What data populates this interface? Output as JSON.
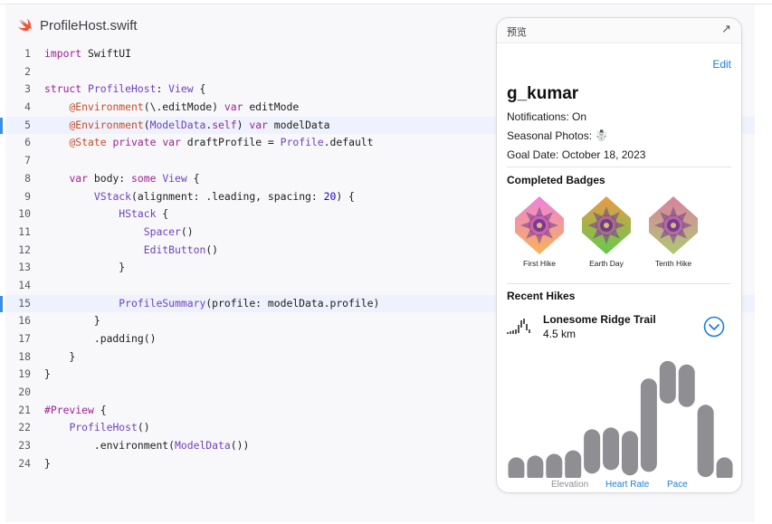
{
  "editor": {
    "file_title": "ProfileHost.swift",
    "lines": [
      {
        "n": "1",
        "html": "<span class=\"kw\">import</span> SwiftUI"
      },
      {
        "n": "2",
        "html": ""
      },
      {
        "n": "3",
        "html": "<span class=\"kw\">struct</span> <span class=\"ty\">ProfileHost</span>: <span class=\"ty\">View</span> {"
      },
      {
        "n": "4",
        "html": "    <span class=\"at\">@Environment</span>(\\.editMode) <span class=\"kw\">var</span> editMode"
      },
      {
        "n": "5",
        "html": "    <span class=\"at\">@Environment</span>(<span class=\"ty\">ModelData</span>.<span class=\"kw\">self</span>) <span class=\"kw\">var</span> modelData",
        "hl": true
      },
      {
        "n": "6",
        "html": "    <span class=\"at\">@State</span> <span class=\"kw\">private</span> <span class=\"kw\">var</span> draftProfile = <span class=\"ty\">Profile</span>.default"
      },
      {
        "n": "7",
        "html": ""
      },
      {
        "n": "8",
        "html": "    <span class=\"kw\">var</span> body: <span class=\"kw\">some</span> <span class=\"ty\">View</span> {"
      },
      {
        "n": "9",
        "html": "        <span class=\"ty\">VStack</span>(alignment: .leading, spacing: <span class=\"nm\">20</span>) {"
      },
      {
        "n": "10",
        "html": "            <span class=\"ty\">HStack</span> {"
      },
      {
        "n": "11",
        "html": "                <span class=\"ty\">Spacer</span>()"
      },
      {
        "n": "12",
        "html": "                <span class=\"ty\">EditButton</span>()"
      },
      {
        "n": "13",
        "html": "            }"
      },
      {
        "n": "14",
        "html": ""
      },
      {
        "n": "15",
        "html": "            <span class=\"ty\">ProfileSummary</span>(profile: modelData.profile)",
        "hl": true
      },
      {
        "n": "16",
        "html": "        }"
      },
      {
        "n": "17",
        "html": "        .padding()"
      },
      {
        "n": "18",
        "html": "    }"
      },
      {
        "n": "19",
        "html": "}"
      },
      {
        "n": "20",
        "html": ""
      },
      {
        "n": "21",
        "html": "<span class=\"kw\">#Preview</span> {"
      },
      {
        "n": "22",
        "html": "    <span class=\"ty\">ProfileHost</span>()"
      },
      {
        "n": "23",
        "html": "        .environment(<span class=\"ty\">ModelData</span>())"
      },
      {
        "n": "24",
        "html": "}"
      }
    ]
  },
  "preview": {
    "title": "预览",
    "expand_icon": "arrow-up-right-icon",
    "edit_label": "Edit",
    "username": "g_kumar",
    "notifications": "Notifications: On",
    "seasonal_photos": "Seasonal Photos: ☃️",
    "goal_date": "Goal Date: October 18, 2023",
    "badges_title": "Completed Badges",
    "badges": [
      {
        "label": "First Hike",
        "hue": "hsl(310,75%,72%)",
        "hue2": "hsl(35,90%,65%)"
      },
      {
        "label": "Earth Day",
        "hue": "hsl(30,80%,60%)",
        "hue2": "hsl(110,55%,55%)"
      },
      {
        "label": "Tenth Hike",
        "hue": "hsl(340,55%,68%)",
        "hue2": "hsl(80,45%,62%)"
      }
    ],
    "recent_title": "Recent Hikes",
    "hike_name": "Lonesome Ridge Trail",
    "hike_distance": "4.5 km",
    "tabs": [
      {
        "label": "Elevation",
        "color": "#8e8e93"
      },
      {
        "label": "Heart Rate",
        "color": "#1a7fe0"
      },
      {
        "label": "Pace",
        "color": "#1a7fe0"
      }
    ]
  },
  "chart_data": {
    "type": "bar",
    "series": [
      {
        "values": [
          [
            0,
            10
          ],
          [
            0,
            12
          ],
          [
            0,
            14
          ],
          [
            0,
            18
          ],
          [
            10,
            42
          ],
          [
            14,
            44
          ],
          [
            8,
            40
          ],
          [
            12,
            100
          ],
          [
            90,
            120
          ],
          [
            86,
            116
          ],
          [
            6,
            70
          ],
          [
            0,
            10
          ]
        ]
      }
    ],
    "ylim": [
      0,
      124
    ]
  },
  "colors": {
    "accent": "#1a7fe0",
    "highlight_bar": "#3a8ee6",
    "capsule": "#8e8e93"
  }
}
